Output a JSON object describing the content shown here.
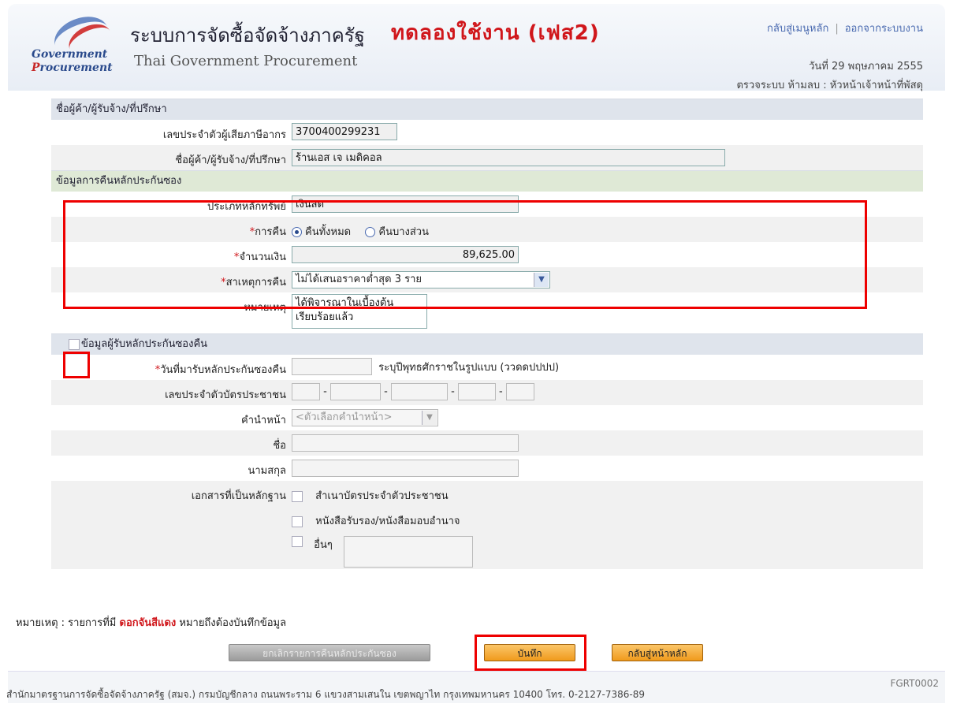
{
  "header": {
    "logo_line1": "Government",
    "logo_line2_a": "P",
    "logo_line2_b": "rocurement",
    "title_th": "ระบบการจัดซื้อจัดจ้างภาครัฐ",
    "title_test": "ทดลองใช้งาน (เฟส2)",
    "title_en": "Thai Government Procurement",
    "link_home": "กลับสู่เมนูหลัก",
    "link_logout": "ออกจากระบบงาน",
    "date": "วันที่ 29 พฤษภาคม 2555",
    "user": "ตรวจระบบ ห้ามลบ : หัวหน้าเจ้าหน้าที่พัสดุ"
  },
  "vendor": {
    "section": "ชื่อผู้ค้า/ผู้รับจ้าง/ที่ปรึกษา",
    "tax_label": "เลขประจำตัวผู้เสียภาษีอากร",
    "tax_value": "3700400299231",
    "name_label": "ชื่อผู้ค้า/ผู้รับจ้าง/ที่ปรึกษา",
    "name_value": "ร้านเอส เจ เมดิคอล"
  },
  "refund": {
    "section": "ข้อมูลการคืนหลักประกันซอง",
    "asset_label": "ประเภทหลักทรัพย์",
    "asset_value": "เงินสด",
    "return_label": "การคืน",
    "return_all": "คืนทั้งหมด",
    "return_partial": "คืนบางส่วน",
    "amount_label": "จำนวนเงิน",
    "amount_value": "89,625.00",
    "reason_label": "สาเหตุการคืน",
    "reason_value": "ไม่ได้เสนอราคาต่ำสุด 3 ราย",
    "remark_label": "หมายเหตุ",
    "remark_line1": "ได้พิจารณาในเบื้องต้น",
    "remark_line2": "เรียบร้อยแล้ว"
  },
  "receiver": {
    "section": "ข้อมูลผู้รับหลักประกันซองคืน",
    "date_label": "วันที่มารับหลักประกันซองคืน",
    "date_hint": "ระบุปีพุทธศักราชในรูปแบบ (ววดดปปปป)",
    "id_label": "เลขประจำตัวบัตรประชาชน",
    "prefix_label": "คำนำหน้า",
    "prefix_value": "<ตัวเลือกคำนำหน้า>",
    "first_label": "ชื่อ",
    "last_label": "นามสกุล",
    "doc_label": "เอกสารที่เป็นหลักฐาน",
    "doc1": "สำเนาบัตรประจำตัวประชาชน",
    "doc2": "หนังสือรับรอง/หนังสือมอบอำนาจ",
    "doc3": "อื่นๆ"
  },
  "note": {
    "prefix": "หมายเหตุ : รายการที่มี",
    "star": "ดอกจันสีแดง",
    "suffix": "หมายถึงต้องบันทึกข้อมูล"
  },
  "buttons": {
    "cancel": "ยกเลิกรายการคืนหลักประกันซอง",
    "save": "บันทึก",
    "back": "กลับสู่หน้าหลัก"
  },
  "footer": {
    "text": "สำนักมาตรฐานการจัดซื้อจัดจ้างภาครัฐ (สมจ.) กรมบัญชีกลาง ถนนพระราม 6 แขวงสามเสนใน เขตพญาไท กรุงเทพมหานคร 10400 โทร. 0-2127-7386-89",
    "code": "FGRT0002"
  },
  "colors": {
    "required_star": "#d0161b",
    "highlight_box": "#e00000",
    "button_orange": "#f09a1c"
  }
}
